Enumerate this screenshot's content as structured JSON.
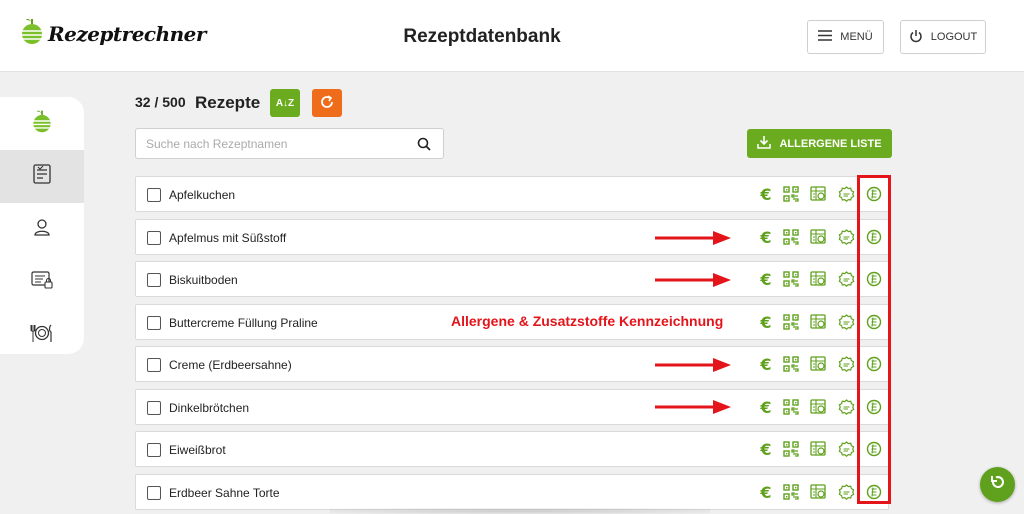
{
  "header": {
    "logo_text": "Rezeptrechner",
    "title": "Rezeptdatenbank",
    "menu_label": "MENÜ",
    "logout_label": "LOGOUT"
  },
  "sidebar": {
    "items": [
      {
        "icon": "apple-logo-icon"
      },
      {
        "icon": "recipe-list-icon",
        "active": true
      },
      {
        "icon": "user-icon"
      },
      {
        "icon": "id-card-lock-icon"
      },
      {
        "icon": "cutlery-plate-icon"
      }
    ]
  },
  "toolbar": {
    "count": "32 / 500",
    "count_label": "Rezepte",
    "sort_label": "A↓Z",
    "search_placeholder": "Suche nach Rezeptnamen",
    "allergen_button": "ALLERGENE LISTE"
  },
  "recipes": [
    "Apfelkuchen",
    "Apfelmus mit Süßstoff",
    "Biskuitboden",
    "Buttercreme Füllung Praline",
    "Creme (Erdbeersahne)",
    "Dinkelbrötchen",
    "Eiweißbrot",
    "Erdbeer Sahne Torte"
  ],
  "row_icons": {
    "euro_symbol": "€",
    "icons": [
      "euro-icon",
      "qr-code-icon",
      "nutrition-label-icon",
      "certificate-badge-icon",
      "allergen-label-icon"
    ]
  },
  "annotation": {
    "text": "Allergene & Zusatzstoffe Kennzeichnung",
    "color": "#e4141b"
  },
  "colors": {
    "brand_green": "#6aab1f",
    "accent_orange": "#ef6d1a"
  }
}
